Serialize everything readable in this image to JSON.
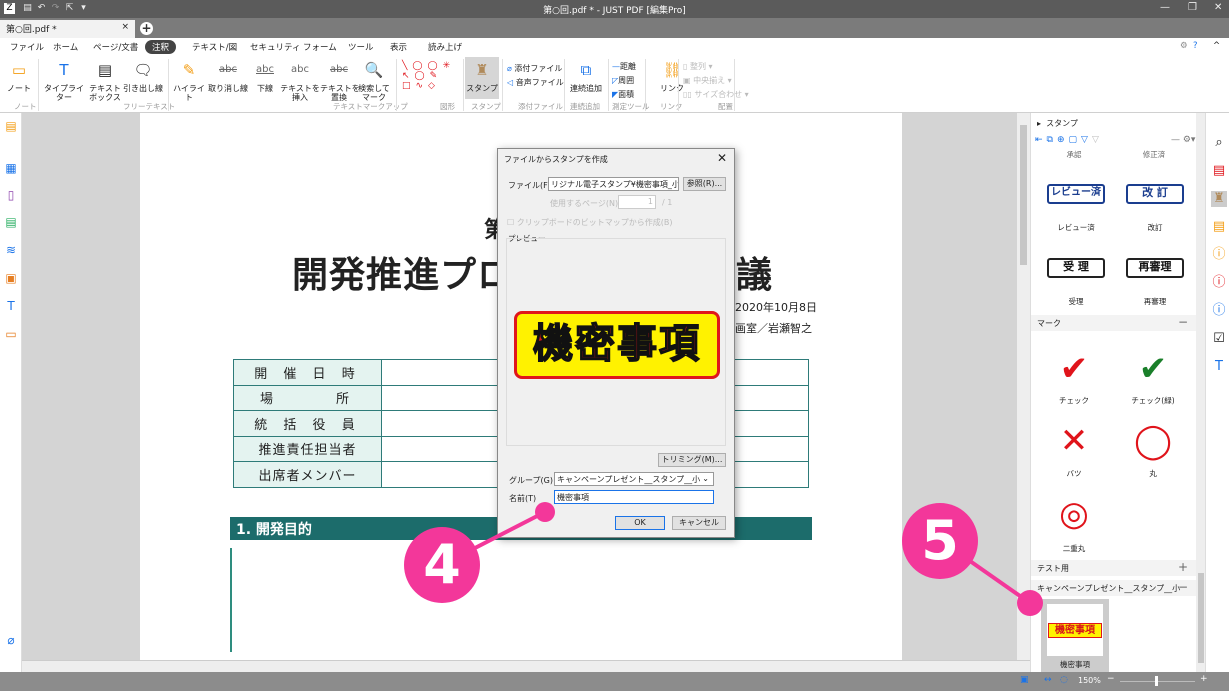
{
  "window": {
    "title": "第○回.pdf * - JUST PDF [編集Pro]"
  },
  "tab": {
    "label": "第○回.pdf *",
    "close": "×",
    "new": "+"
  },
  "menu": [
    "ファイル",
    "ホーム",
    "ページ/文書",
    "注釈",
    "テキスト/図",
    "セキュリティ",
    "フォーム",
    "ツール",
    "表示",
    "読み上げ"
  ],
  "menu_active": "注釈",
  "ribbon": {
    "note": "ノート",
    "typewriter": "タイプライター",
    "textbox": "テキスト\nボックス",
    "callout": "引き出し線",
    "highlight": "ハイライト",
    "strike": "取り消し線",
    "underline": "下線",
    "insert": "テキストを\n挿入",
    "replace": "テキストを\n置換",
    "search_mark": "検索して\nマーク",
    "stamp": "スタンプ",
    "attach_file": "添付ファイル",
    "audio_file": "音声ファイル",
    "continuous": "連続追加",
    "distance": "距離",
    "perimeter": "周囲",
    "area": "面積",
    "link": "リンク",
    "align": "整列",
    "center": "中央揃え",
    "size": "サイズ合わせ",
    "groups": {
      "note": "ノート",
      "free_text": "フリーテキスト",
      "markup": "テキストマークアップ",
      "shape": "図形",
      "stamp": "スタンプ",
      "attach": "添付ファイル",
      "cont": "連続追加",
      "measure": "測定ツール",
      "link": "リンク",
      "layout": "配置"
    },
    "abc": "abc"
  },
  "document": {
    "subtitle": "第",
    "title": "開発推進プロ",
    "title_end": "議",
    "date": "2020年10月8日",
    "author": "画室／岩瀬智之",
    "rows": [
      "開 催 日 時",
      "場　　　所",
      "統 括 役 員",
      "推進責任担当者",
      "出席者メンバー"
    ],
    "section": "1.  開発目的"
  },
  "dialog": {
    "title": "ファイルからスタンプを作成",
    "close": "✕",
    "file_label": "ファイル(F)",
    "file_value": "リジナル電子スタンプ¥機密事項_小.png",
    "browse": "参照(R)...",
    "page_label": "使用するページ(N)",
    "page_value": "1",
    "page_total": "/ 1",
    "clipboard": "クリップボードのビットマップから作成(B)",
    "preview_label": "プレビュー",
    "preview_stamp": "機密事項",
    "trim": "トリミング(M)...",
    "group_label": "グループ(G)",
    "group_value": "キャンペーンプレゼント__スタンプ__小",
    "name_label": "名前(T)",
    "name_value": "機密事項",
    "ok": "OK",
    "cancel": "キャンセル"
  },
  "panel": {
    "title": "スタンプ",
    "top_caps": [
      "承認",
      "修正済"
    ],
    "stamps": [
      {
        "text": "レビュー済",
        "cap": "レビュー済"
      },
      {
        "text": "改 訂",
        "cap": "改訂"
      },
      {
        "text": "受 理",
        "cap": "受理"
      },
      {
        "text": "再審理",
        "cap": "再審理"
      }
    ],
    "mark_section": "マーク",
    "marks": [
      {
        "glyph": "✔",
        "cap": "チェック",
        "color": "#e0141b"
      },
      {
        "glyph": "✔",
        "cap": "チェック(緑)",
        "color": "#1a7f2a"
      },
      {
        "glyph": "✕",
        "cap": "バツ",
        "color": "#e0141b"
      },
      {
        "glyph": "◯",
        "cap": "丸",
        "color": "#e0141b"
      },
      {
        "glyph": "◎",
        "cap": "二重丸",
        "color": "#e0141b"
      }
    ],
    "test_section": "テスト用",
    "campaign_section": "キャンペーンプレゼント__スタンプ__小",
    "campaign_item": {
      "stamp": "機密事項",
      "cap": "機密事項"
    }
  },
  "status": {
    "zoom": "150%"
  },
  "callouts": [
    "4",
    "5"
  ],
  "colors": {
    "teal": "#1c6c6b",
    "callout": "#f3379a",
    "stamp_yellow": "#fff200",
    "stamp_red": "#e0161b"
  }
}
